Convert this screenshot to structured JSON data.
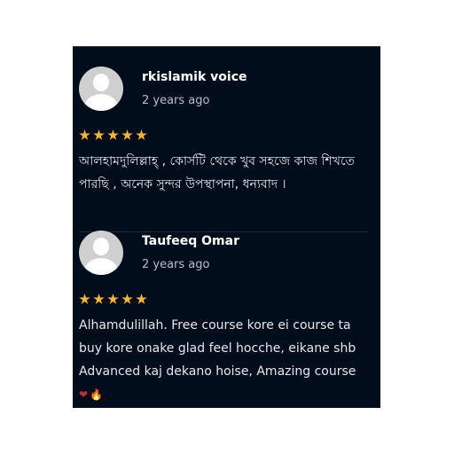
{
  "reviews": [
    {
      "name": "rkislamik voice",
      "date": "2 years ago",
      "rating": 5,
      "text": "আলহামদুলিল্লাহ্ , কোর্সটি থেকে খুব সহজে কাজ শিখতে পারছি , অনেক সুন্দর উপস্থাপনা, ধন্যবাদ ।"
    },
    {
      "name": "Taufeeq Omar",
      "date": "2 years ago",
      "rating": 5,
      "text": "Alhamdulillah. Free course kore ei course ta buy kore onake glad feel hocche, eikane shb Advanced kaj dekano hoise, Amazing course",
      "emojis": [
        "❤",
        "🔥"
      ]
    }
  ],
  "colors": {
    "panel_bg": "#020d1c",
    "star": "#f7b42c",
    "name": "#ffffff",
    "date": "#b9bec6"
  }
}
